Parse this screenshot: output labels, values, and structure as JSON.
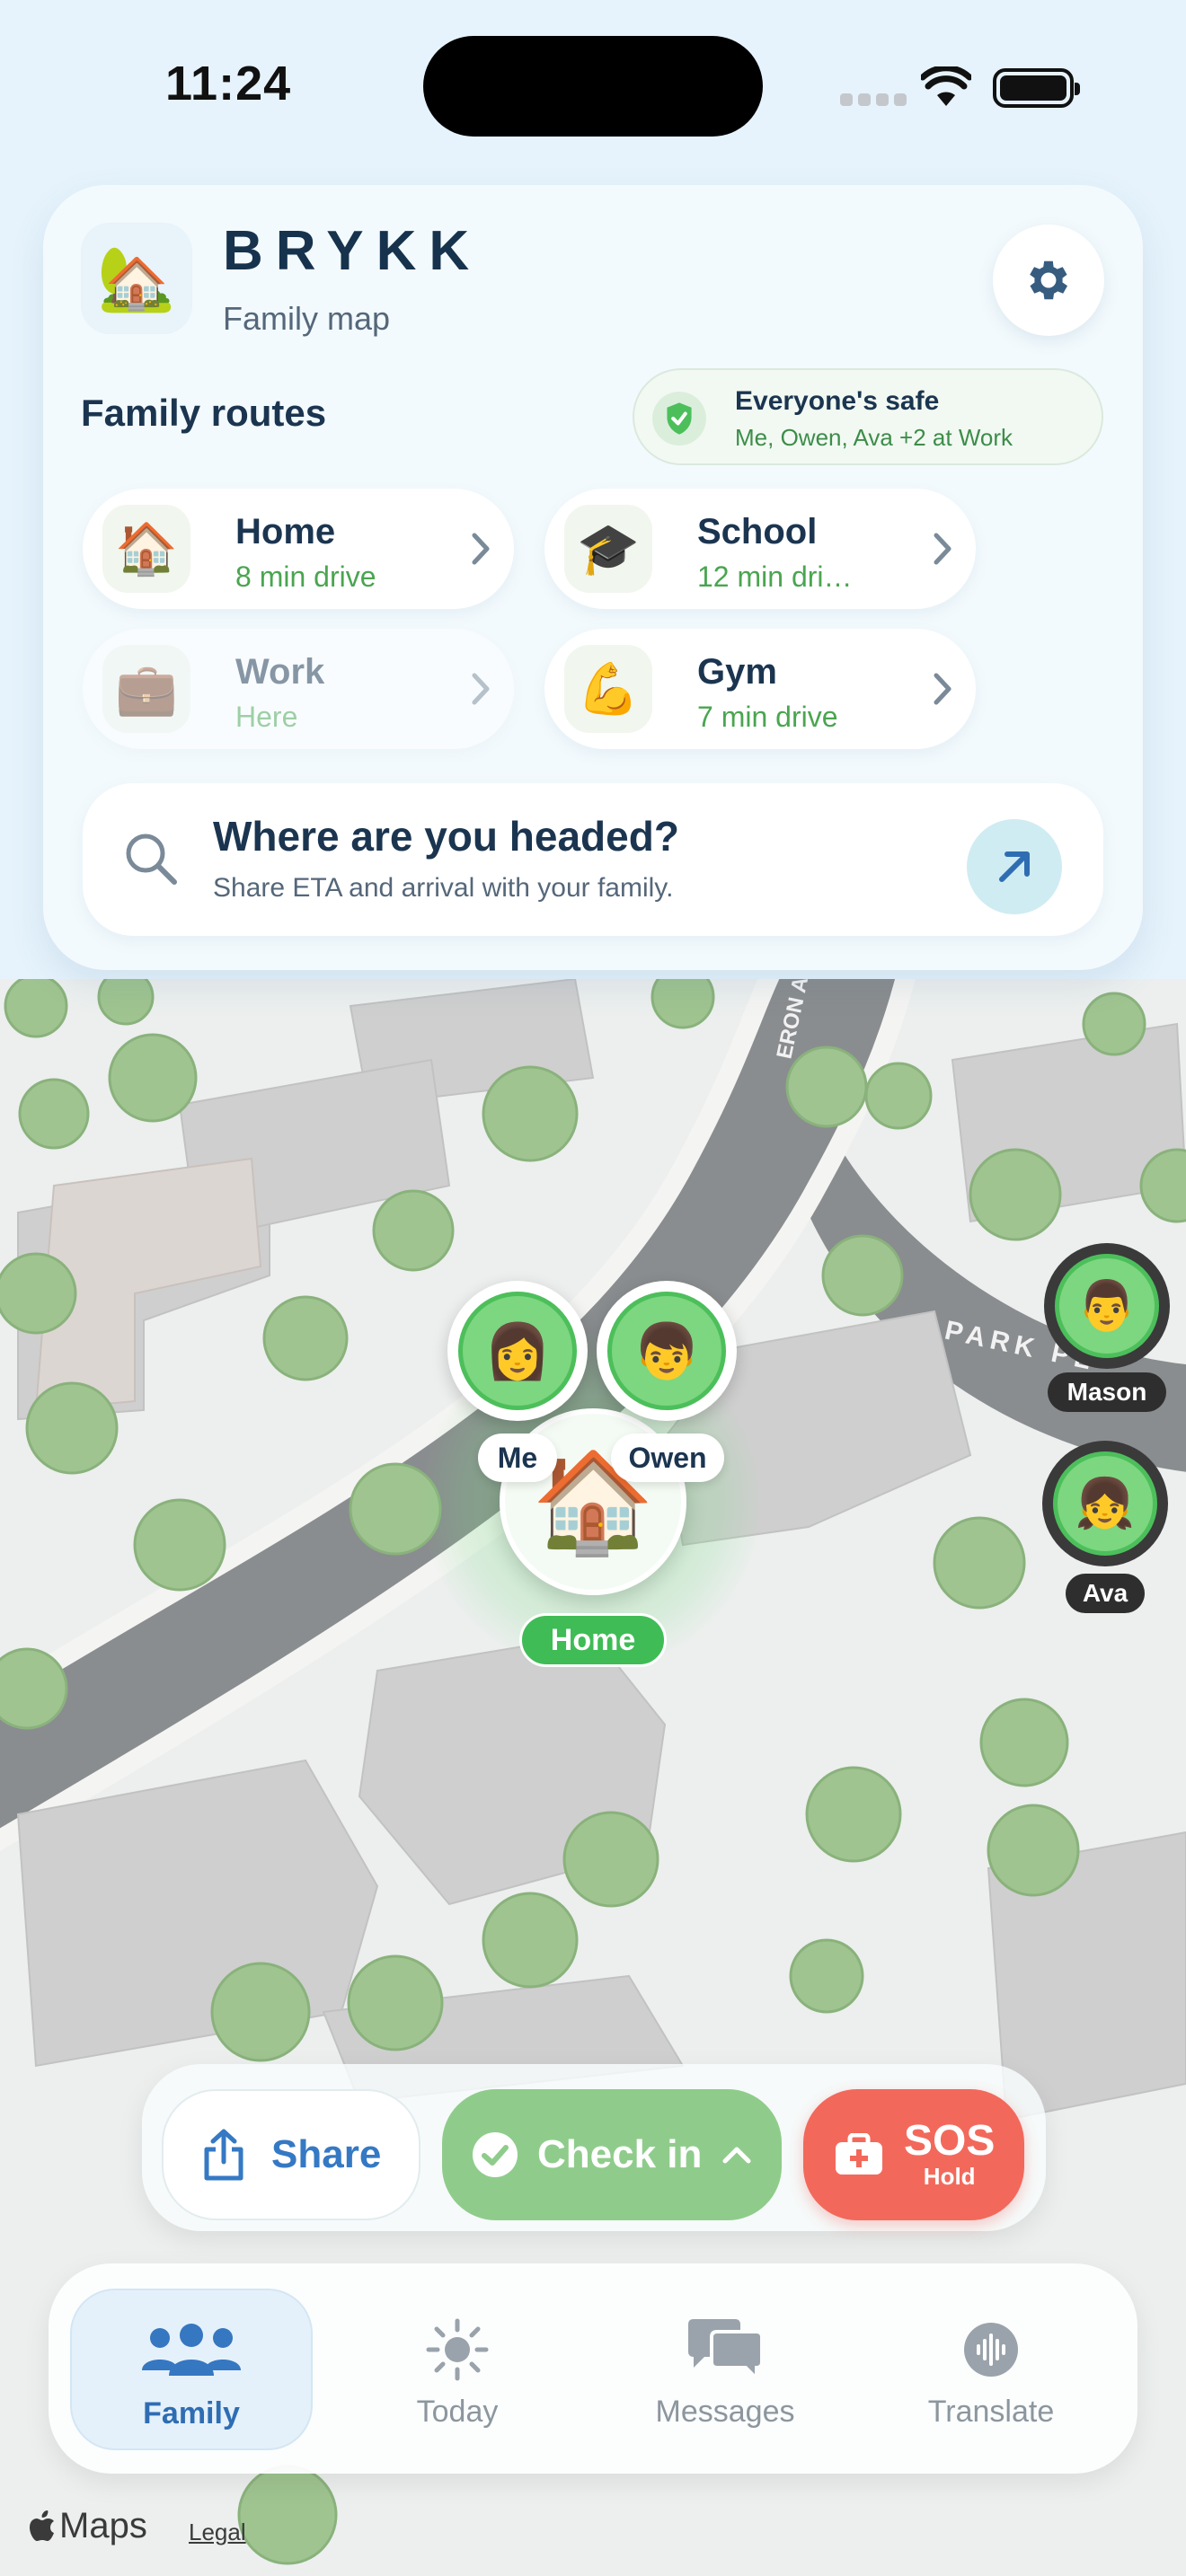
{
  "status": {
    "time": "11:24"
  },
  "header": {
    "app_name": "BRYKK",
    "subtitle": "Family map",
    "logo_emoji": "🏡",
    "settings_icon": "gear-icon"
  },
  "routes": {
    "title": "Family routes",
    "safe": {
      "title": "Everyone's safe",
      "detail": "Me, Owen, Ava +2 at Work"
    },
    "items": [
      {
        "emoji": "🏠",
        "name": "Home",
        "sub": "8 min drive",
        "dim": false
      },
      {
        "emoji": "🎓",
        "name": "School",
        "sub": "12 min dri…",
        "dim": false
      },
      {
        "emoji": "💼",
        "name": "Work",
        "sub": "Here",
        "dim": true
      },
      {
        "emoji": "💪",
        "name": "Gym",
        "sub": "7 min drive",
        "dim": false
      }
    ]
  },
  "search": {
    "title": "Where are you headed?",
    "subtitle": "Share ETA and arrival with your family."
  },
  "map": {
    "street_1": "ERON A",
    "street_2": "PARK PL",
    "home": {
      "emoji": "🏠",
      "label": "Home"
    },
    "members": [
      {
        "emoji": "👩",
        "label": "Me"
      },
      {
        "emoji": "👦",
        "label": "Owen"
      },
      {
        "emoji": "👨",
        "label": "Mason"
      },
      {
        "emoji": "👧",
        "label": "Ava"
      }
    ]
  },
  "actions": {
    "share": "Share",
    "checkin": "Check in",
    "sos": "SOS",
    "sos_sub": "Hold"
  },
  "tabs": [
    {
      "label": "Family",
      "active": true
    },
    {
      "label": "Today",
      "active": false
    },
    {
      "label": "Messages",
      "active": false
    },
    {
      "label": "Translate",
      "active": false
    }
  ],
  "footer": {
    "maps": "Maps",
    "legal": "Legal"
  },
  "colors": {
    "accent_green": "#4cbf5b",
    "accent_blue": "#2f6db3",
    "sos_red": "#f2695c",
    "ink": "#1b3550"
  }
}
